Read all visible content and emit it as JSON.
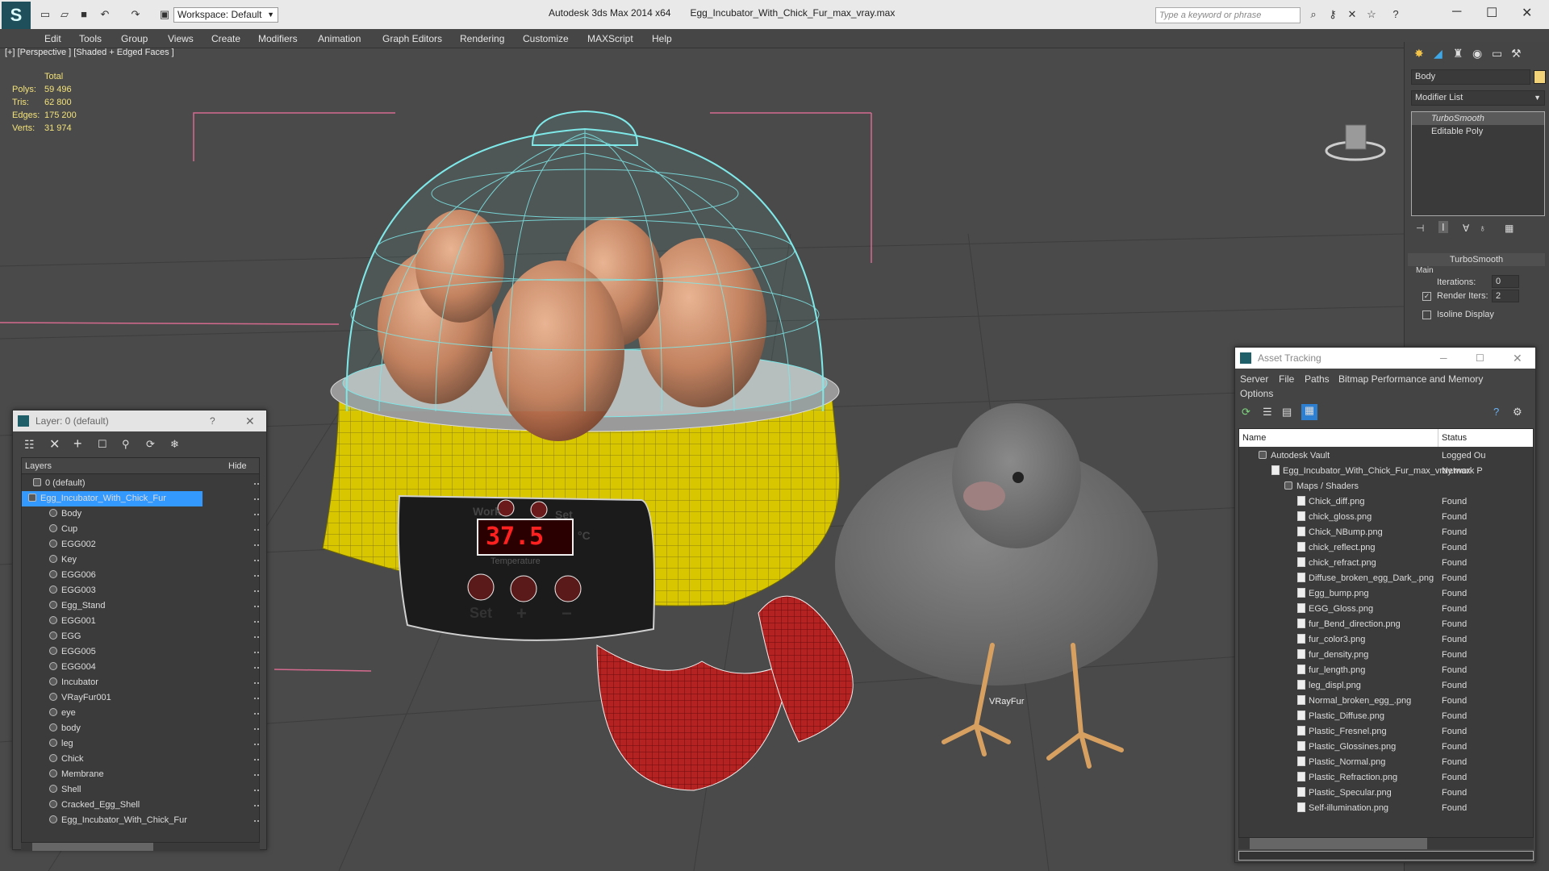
{
  "app": {
    "name": "Autodesk 3ds Max  2014 x64",
    "file": "Egg_Incubator_With_Chick_Fur_max_vray.max",
    "workspace": "Workspace: Default",
    "search_placeholder": "Type a keyword or phrase"
  },
  "menu": [
    "Edit",
    "Tools",
    "Group",
    "Views",
    "Create",
    "Modifiers",
    "Animation",
    "Graph Editors",
    "Rendering",
    "Customize",
    "MAXScript",
    "Help"
  ],
  "viewport": {
    "label": "[+] [Perspective ] [Shaded + Edged Faces ]",
    "stats": {
      "header": "Total",
      "rows": [
        {
          "label": "Polys:",
          "value": "59 496"
        },
        {
          "label": "Tris:",
          "value": "62 800"
        },
        {
          "label": "Edges:",
          "value": "175 200"
        },
        {
          "label": "Verts:",
          "value": "31 974"
        }
      ]
    },
    "display_text": "37.5",
    "work_label": "Work",
    "set_label": "Set",
    "temp_label": "Temperature",
    "celsius": "°C",
    "set_bottom": "Set",
    "plus": "+",
    "minus": "−",
    "vrayfur_label": "VRayFur"
  },
  "command_panel": {
    "object_name": "Body",
    "modifier_list": "Modifier List",
    "stack": [
      "TurboSmooth",
      "Editable Poly"
    ],
    "rollout_title": "TurboSmooth",
    "group_main": "Main",
    "iterations_label": "Iterations:",
    "iterations_value": "0",
    "render_iters_label": "Render Iters:",
    "render_iters_value": "2",
    "isoline_label": "Isoline Display"
  },
  "layer_window": {
    "title": "Layer: 0 (default)",
    "help": "?",
    "col_layers": "Layers",
    "col_hide": "Hide",
    "top_layers": [
      "0 (default)",
      "Egg_Incubator_With_Chick_Fur"
    ],
    "objects": [
      "Body",
      "Cup",
      "EGG002",
      "Key",
      "EGG006",
      "EGG003",
      "Egg_Stand",
      "EGG001",
      "EGG",
      "EGG005",
      "EGG004",
      "Incubator",
      "VRayFur001",
      "eye",
      "body",
      "leg",
      "Chick",
      "Membrane",
      "Shell",
      "Cracked_Egg_Shell",
      "Egg_Incubator_With_Chick_Fur"
    ]
  },
  "asset_window": {
    "title": "Asset Tracking",
    "menu": [
      "Server",
      "File",
      "Paths",
      "Bitmap Performance and Memory"
    ],
    "menu2": "Options",
    "col_name": "Name",
    "col_status": "Status",
    "vault": {
      "name": "Autodesk Vault",
      "status": "Logged Ou"
    },
    "maxfile": {
      "name": "Egg_Incubator_With_Chick_Fur_max_vray.max",
      "status": "Network P"
    },
    "folder": "Maps / Shaders",
    "files": [
      {
        "name": "Chick_diff.png",
        "status": "Found"
      },
      {
        "name": "chick_gloss.png",
        "status": "Found"
      },
      {
        "name": "Chick_NBump.png",
        "status": "Found"
      },
      {
        "name": "chick_reflect.png",
        "status": "Found"
      },
      {
        "name": "chick_refract.png",
        "status": "Found"
      },
      {
        "name": "Diffuse_broken_egg_Dark_.png",
        "status": "Found"
      },
      {
        "name": "Egg_bump.png",
        "status": "Found"
      },
      {
        "name": "EGG_Gloss.png",
        "status": "Found"
      },
      {
        "name": "fur_Bend_direction.png",
        "status": "Found"
      },
      {
        "name": "fur_color3.png",
        "status": "Found"
      },
      {
        "name": "fur_density.png",
        "status": "Found"
      },
      {
        "name": "fur_length.png",
        "status": "Found"
      },
      {
        "name": "leg_displ.png",
        "status": "Found"
      },
      {
        "name": "Normal_broken_egg_.png",
        "status": "Found"
      },
      {
        "name": "Plastic_Diffuse.png",
        "status": "Found"
      },
      {
        "name": "Plastic_Fresnel.png",
        "status": "Found"
      },
      {
        "name": "Plastic_Glossines.png",
        "status": "Found"
      },
      {
        "name": "Plastic_Normal.png",
        "status": "Found"
      },
      {
        "name": "Plastic_Refraction.png",
        "status": "Found"
      },
      {
        "name": "Plastic_Specular.png",
        "status": "Found"
      },
      {
        "name": "Self-illumination.png",
        "status": "Found"
      }
    ]
  },
  "colors": {
    "accent": "#3399ff",
    "selection": "#1e6fd9",
    "stats": "#f3e27a",
    "wire_cyan": "#7fe8e8",
    "yellow": "#d6c400"
  }
}
